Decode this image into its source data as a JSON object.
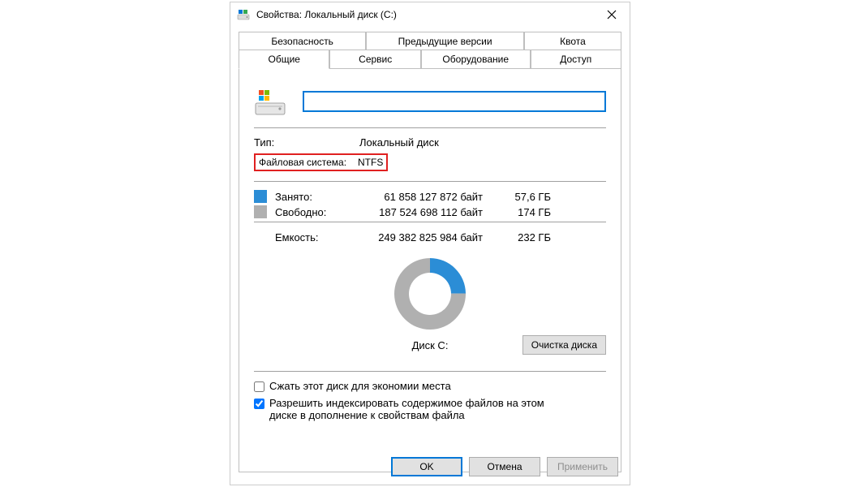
{
  "window": {
    "title": "Свойства: Локальный диск (C:)"
  },
  "tabs": {
    "row1": [
      "Безопасность",
      "Предыдущие версии",
      "Квота"
    ],
    "row2": [
      "Общие",
      "Сервис",
      "Оборудование",
      "Доступ"
    ],
    "active": "Общие"
  },
  "drive": {
    "name": "",
    "type_label": "Тип:",
    "type_value": "Локальный диск",
    "fs_label": "Файловая система:",
    "fs_value": "NTFS"
  },
  "usage": {
    "used_label": "Занято:",
    "used_bytes": "61 858 127 872 байт",
    "used_size": "57,6 ГБ",
    "free_label": "Свободно:",
    "free_bytes": "187 524 698 112 байт",
    "free_size": "174 ГБ",
    "capacity_label": "Емкость:",
    "capacity_bytes": "249 382 825 984 байт",
    "capacity_size": "232 ГБ",
    "used_color": "#2b8dd6",
    "free_color": "#b0b0b0",
    "used_fraction": 0.248
  },
  "disk_label": "Диск C:",
  "cleanup_button": "Очистка диска",
  "compress_label": "Сжать этот диск для экономии места",
  "compress_checked": false,
  "index_label": "Разрешить индексировать содержимое файлов на этом диске в дополнение к свойствам файла",
  "index_checked": true,
  "buttons": {
    "ok": "OK",
    "cancel": "Отмена",
    "apply": "Применить"
  },
  "chart_data": {
    "type": "pie",
    "title": "Диск C:",
    "series": [
      {
        "name": "Занято",
        "value": 61858127872,
        "color": "#2b8dd6"
      },
      {
        "name": "Свободно",
        "value": 187524698112,
        "color": "#b0b0b0"
      }
    ]
  }
}
